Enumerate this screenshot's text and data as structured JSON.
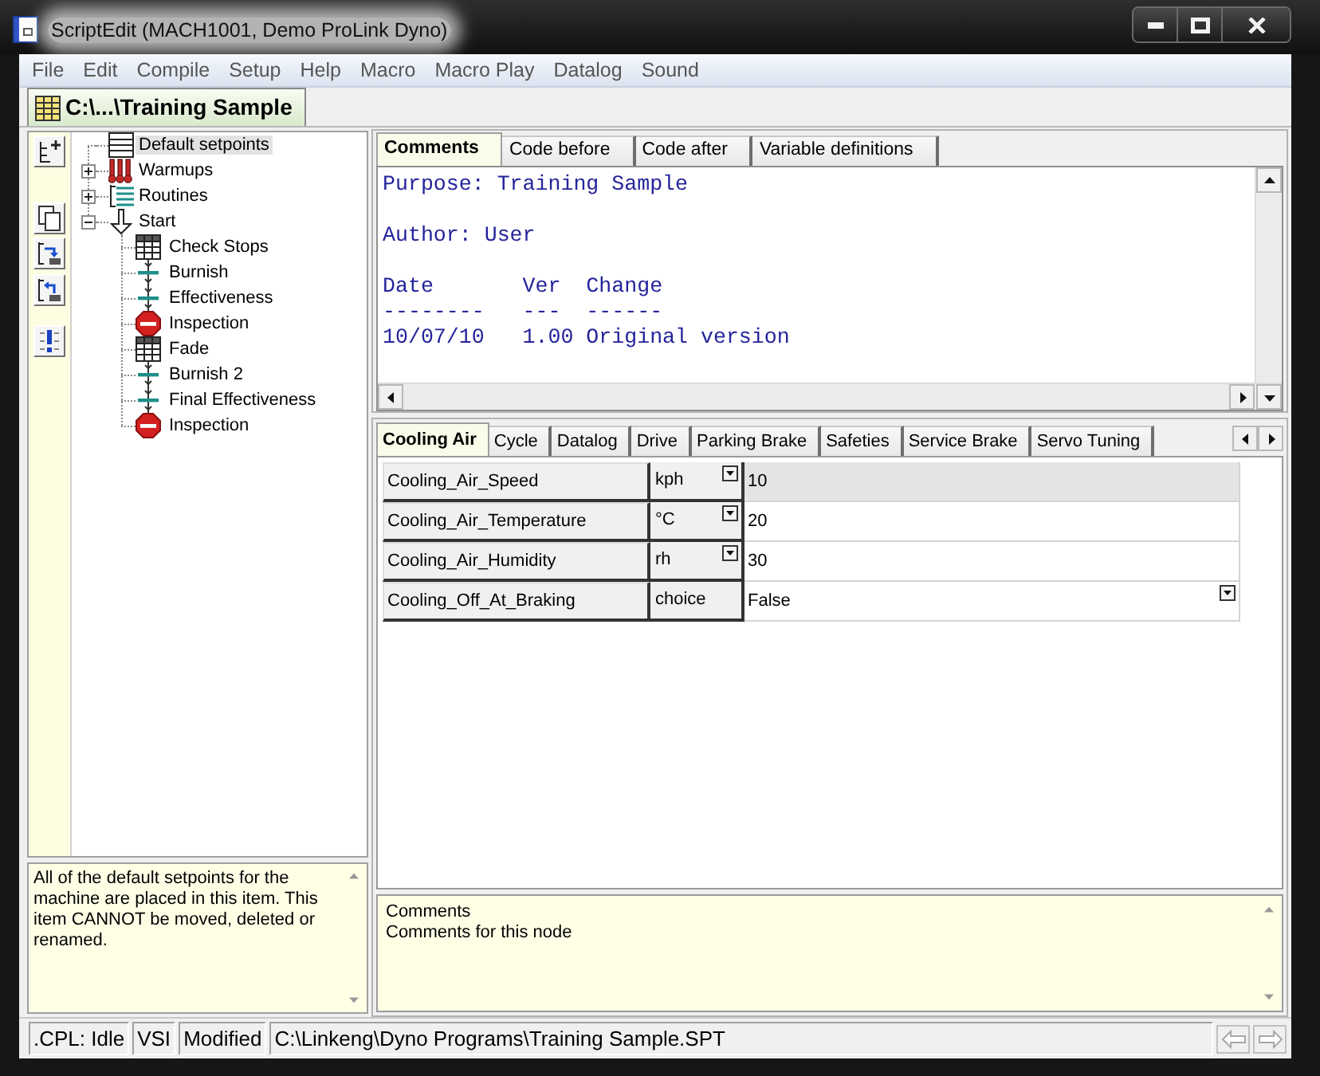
{
  "window": {
    "title": "ScriptEdit (MACH1001, Demo ProLink Dyno)"
  },
  "menu": [
    "File",
    "Edit",
    "Compile",
    "Setup",
    "Help",
    "Macro",
    "Macro Play",
    "Datalog",
    "Sound"
  ],
  "document_tabs": [
    {
      "label": "C:\\...\\Training Sample",
      "selected": true
    }
  ],
  "tree": {
    "items": [
      {
        "label": "Default setpoints",
        "kind": "list",
        "selected": true
      },
      {
        "label": "Warmups",
        "kind": "thermometers",
        "selected": false,
        "expanded": false
      },
      {
        "label": "Routines",
        "kind": "list-tree",
        "selected": false,
        "expanded": false
      },
      {
        "label": "Start",
        "kind": "arrow",
        "selected": false,
        "expanded": true,
        "children": [
          {
            "label": "Check Stops",
            "kind": "grid",
            "selected": false
          },
          {
            "label": "Burnish",
            "kind": "step",
            "selected": false
          },
          {
            "label": "Effectiveness",
            "kind": "step",
            "selected": false
          },
          {
            "label": "Inspection",
            "kind": "stop",
            "selected": false
          },
          {
            "label": "Fade",
            "kind": "grid",
            "selected": false
          },
          {
            "label": "Burnish 2",
            "kind": "step",
            "selected": false
          },
          {
            "label": "Final Effectiveness",
            "kind": "step",
            "selected": false
          },
          {
            "label": "Inspection",
            "kind": "stop",
            "selected": false
          }
        ]
      }
    ]
  },
  "help_text": "All of the default setpoints for the machine are placed in this item. This item CANNOT be moved, deleted or renamed.",
  "editor_tabs": [
    {
      "label": "Comments",
      "selected": true
    },
    {
      "label": "Code before",
      "selected": false
    },
    {
      "label": "Code after",
      "selected": false
    },
    {
      "label": "Variable definitions",
      "selected": false
    }
  ],
  "comments": {
    "paragraphs": [
      [
        "Purpose: Training Sample"
      ],
      [
        "Author: User"
      ],
      [
        "Date       Ver  Change",
        "--------   ---  ------",
        "10/07/10   1.00 Original version"
      ]
    ]
  },
  "parameter_tabs": [
    {
      "label": "Cooling Air",
      "selected": true
    },
    {
      "label": "Cycle",
      "selected": false
    },
    {
      "label": "Datalog",
      "selected": false
    },
    {
      "label": "Drive",
      "selected": false
    },
    {
      "label": "Parking Brake",
      "selected": false
    },
    {
      "label": "Safeties",
      "selected": false
    },
    {
      "label": "Service Brake",
      "selected": false
    },
    {
      "label": "Servo Tuning",
      "selected": false
    }
  ],
  "parameters": {
    "rows": [
      {
        "name": "Cooling_Air_Speed",
        "unit": "kph",
        "value": "10",
        "kind": "number",
        "selected": true
      },
      {
        "name": "Cooling_Air_Temperature",
        "unit": "°C",
        "value": "20",
        "kind": "number",
        "selected": false
      },
      {
        "name": "Cooling_Air_Humidity",
        "unit": "rh",
        "value": "30",
        "kind": "number",
        "selected": false
      },
      {
        "name": "Cooling_Off_At_Braking",
        "unit": "choice",
        "value": "False",
        "kind": "choice",
        "selected": false
      }
    ]
  },
  "node_comments": {
    "lines": [
      "Comments",
      "Comments for this node"
    ]
  },
  "status_bar": {
    "panels": [
      ".CPL: Idle",
      "VSI",
      "Modified",
      "C:\\Linkeng\\Dyno Programs\\Training Sample.SPT"
    ],
    "nav_buttons": [
      {
        "kind": "back",
        "disabled": true
      },
      {
        "kind": "forward",
        "disabled": true
      }
    ]
  }
}
